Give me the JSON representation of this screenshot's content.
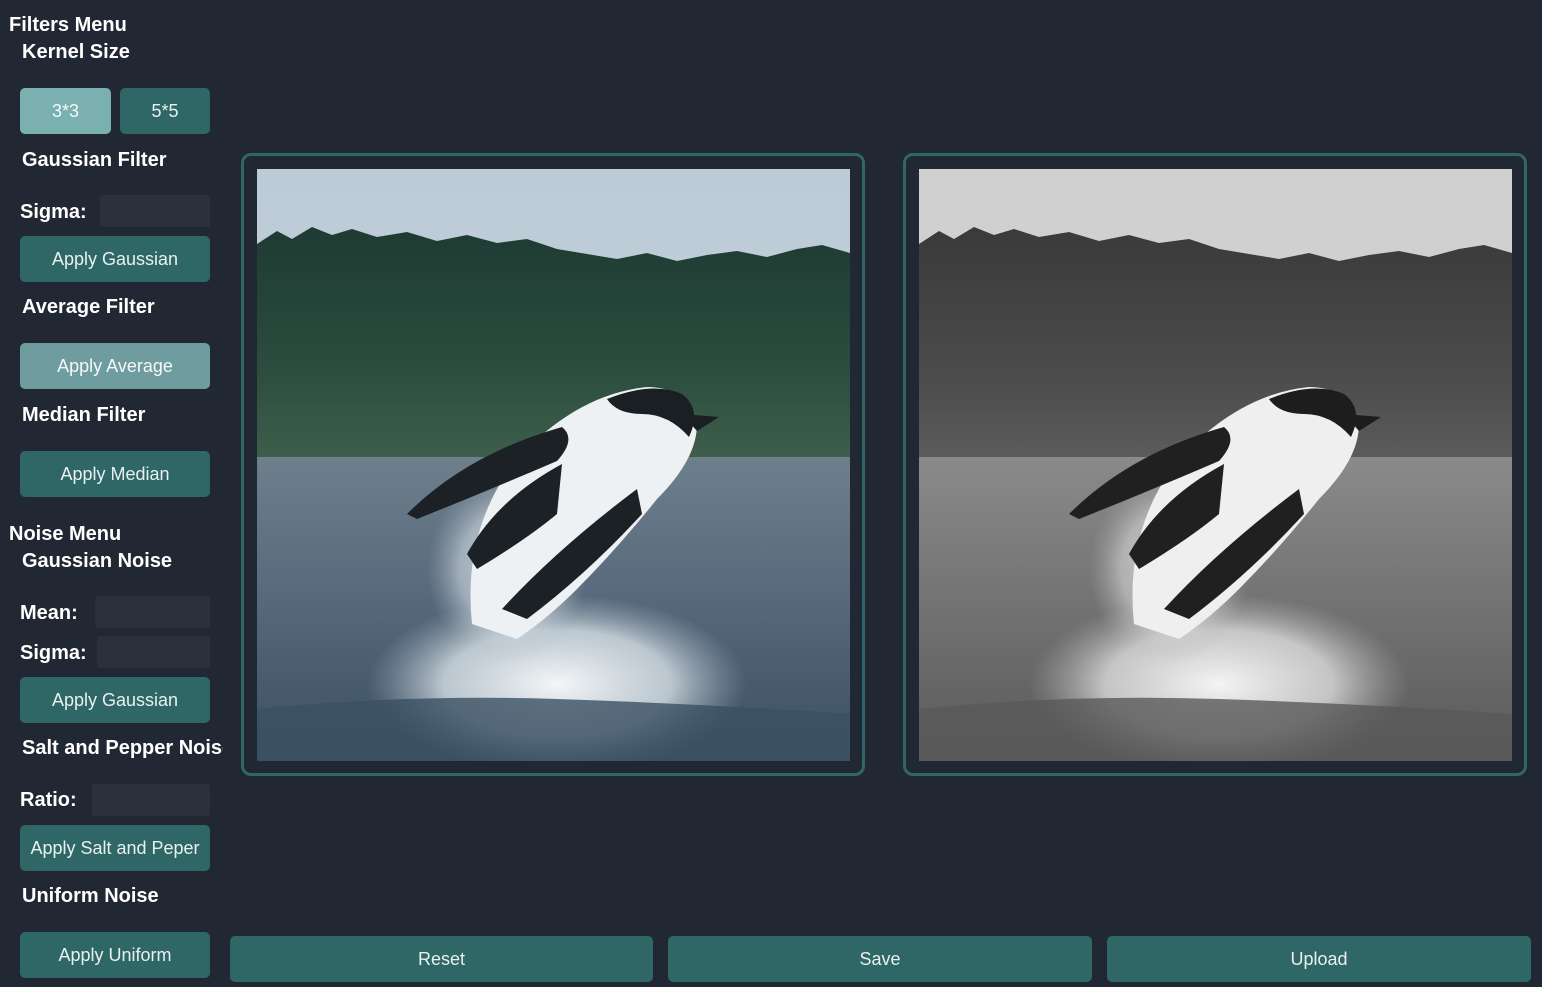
{
  "filters": {
    "title": "Filters Menu",
    "kernel_title": "Kernel Size",
    "kernel_options": [
      "3*3",
      "5*5"
    ],
    "gaussian": {
      "title": "Gaussian Filter",
      "sigma_label": "Sigma:",
      "sigma_value": "",
      "apply_label": "Apply Gaussian"
    },
    "average": {
      "title": "Average Filter",
      "apply_label": "Apply Average"
    },
    "median": {
      "title": "Median Filter",
      "apply_label": "Apply Median"
    }
  },
  "noise": {
    "title": "Noise Menu",
    "gaussian": {
      "title": "Gaussian Noise",
      "mean_label": "Mean:",
      "mean_value": "",
      "sigma_label": "Sigma:",
      "sigma_value": "",
      "apply_label": "Apply Gaussian"
    },
    "salt_pepper": {
      "title": "Salt and Pepper Noise",
      "ratio_label": "Ratio:",
      "ratio_value": "",
      "apply_label": "Apply Salt and Peper"
    },
    "uniform": {
      "title": "Uniform Noise",
      "apply_label": "Apply Uniform"
    }
  },
  "bottom_bar": {
    "reset_label": "Reset",
    "save_label": "Save",
    "upload_label": "Upload"
  },
  "colors": {
    "background": "#212833",
    "accent": "#2e6766",
    "accent_active": "#7ab0b0",
    "input_bg": "#2b313c"
  }
}
